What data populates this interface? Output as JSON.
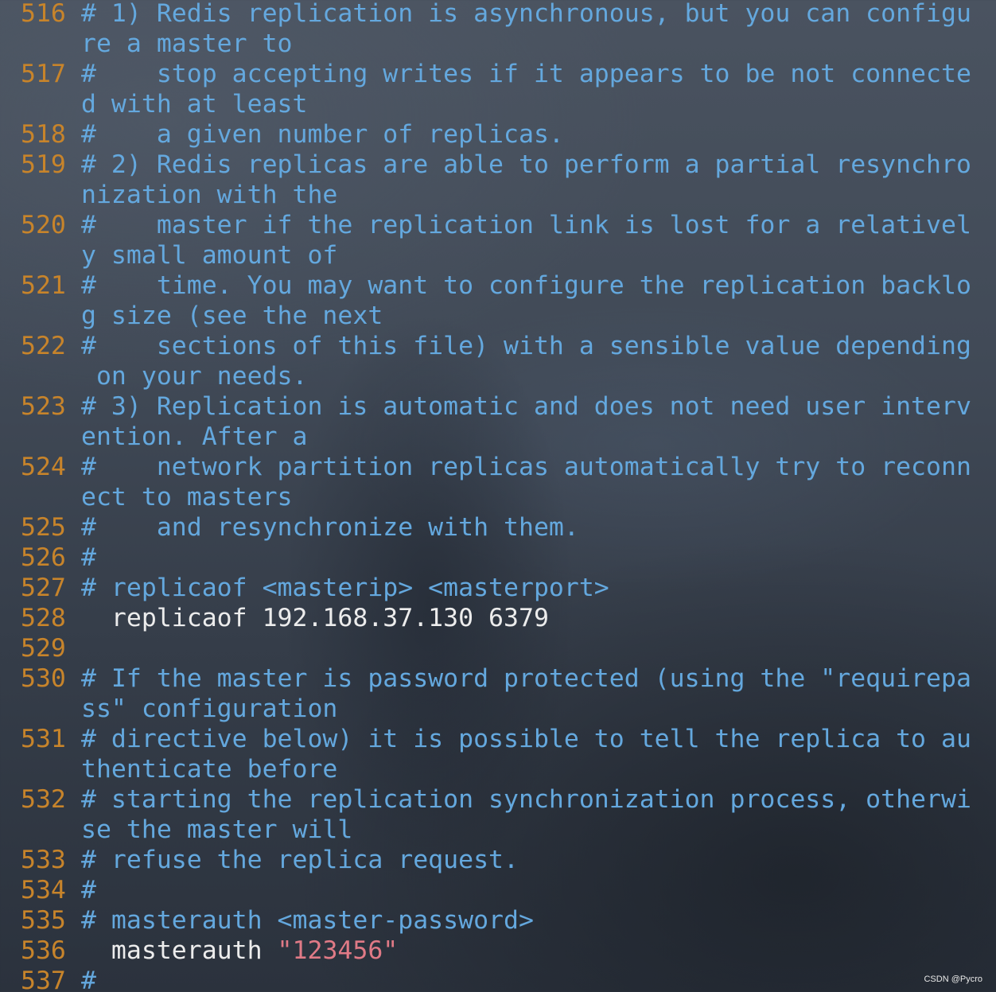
{
  "colors": {
    "line_number": "#c7842b",
    "comment": "#64a8de",
    "plain_text": "#ececec",
    "string": "#e07a86"
  },
  "watermark": "CSDN @Pycro",
  "lines": [
    {
      "number": "516",
      "text": "# 1) Redis replication is asynchronous, but you can configu",
      "type": "comment"
    },
    {
      "number": "",
      "text": "re a master to",
      "type": "comment"
    },
    {
      "number": "517",
      "text": "#    stop accepting writes if it appears to be not connecte",
      "type": "comment"
    },
    {
      "number": "",
      "text": "d with at least",
      "type": "comment"
    },
    {
      "number": "518",
      "text": "#    a given number of replicas.",
      "type": "comment"
    },
    {
      "number": "519",
      "text": "# 2) Redis replicas are able to perform a partial resynchro",
      "type": "comment"
    },
    {
      "number": "",
      "text": "nization with the",
      "type": "comment"
    },
    {
      "number": "520",
      "text": "#    master if the replication link is lost for a relativel",
      "type": "comment"
    },
    {
      "number": "",
      "text": "y small amount of",
      "type": "comment"
    },
    {
      "number": "521",
      "text": "#    time. You may want to configure the replication backlo",
      "type": "comment"
    },
    {
      "number": "",
      "text": "g size (see the next",
      "type": "comment"
    },
    {
      "number": "522",
      "text": "#    sections of this file) with a sensible value depending",
      "type": "comment"
    },
    {
      "number": "",
      "text": " on your needs.",
      "type": "comment"
    },
    {
      "number": "523",
      "text": "# 3) Replication is automatic and does not need user interv",
      "type": "comment"
    },
    {
      "number": "",
      "text": "ention. After a",
      "type": "comment"
    },
    {
      "number": "524",
      "text": "#    network partition replicas automatically try to reconn",
      "type": "comment"
    },
    {
      "number": "",
      "text": "ect to masters",
      "type": "comment"
    },
    {
      "number": "525",
      "text": "#    and resynchronize with them.",
      "type": "comment"
    },
    {
      "number": "526",
      "text": "#",
      "type": "comment"
    },
    {
      "number": "527",
      "text": "# replicaof <masterip> <masterport>",
      "type": "comment"
    },
    {
      "number": "528",
      "text": "  replicaof 192.168.37.130 6379",
      "type": "code"
    },
    {
      "number": "529",
      "text": "",
      "type": "code"
    },
    {
      "number": "530",
      "text": "# If the master is password protected (using the \"requirepa",
      "type": "comment"
    },
    {
      "number": "",
      "text": "ss\" configuration",
      "type": "comment"
    },
    {
      "number": "531",
      "text": "# directive below) it is possible to tell the replica to au",
      "type": "comment"
    },
    {
      "number": "",
      "text": "thenticate before",
      "type": "comment"
    },
    {
      "number": "532",
      "text": "# starting the replication synchronization process, otherwi",
      "type": "comment"
    },
    {
      "number": "",
      "text": "se the master will",
      "type": "comment"
    },
    {
      "number": "533",
      "text": "# refuse the replica request.",
      "type": "comment"
    },
    {
      "number": "534",
      "text": "#",
      "type": "comment"
    },
    {
      "number": "535",
      "text": "# masterauth <master-password>",
      "type": "comment"
    },
    {
      "number": "536",
      "text": "  masterauth ",
      "type": "code",
      "string": "\"123456\""
    },
    {
      "number": "537",
      "text": "#",
      "type": "comment"
    }
  ]
}
